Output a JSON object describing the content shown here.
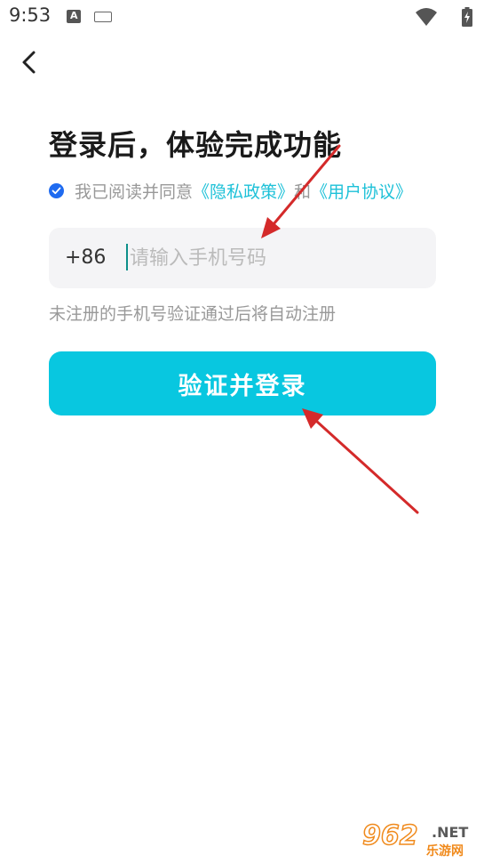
{
  "status_bar": {
    "time": "9:53",
    "app_icon_letter": "A",
    "icons": [
      "a-notification-icon",
      "keyboard-icon",
      "wifi-icon",
      "battery-charging-icon"
    ]
  },
  "header": {
    "back_icon": "chevron-left-icon"
  },
  "title": "登录后，体验完成功能",
  "agreement": {
    "checked": true,
    "prefix": "我已阅读并同意",
    "privacy_link": "《隐私政策》",
    "and": "和",
    "terms_link": "《用户协议》"
  },
  "phone": {
    "country_code": "+86",
    "placeholder": "请输入手机号码",
    "value": ""
  },
  "hint": "未注册的手机号验证通过后将自动注册",
  "submit_label": "验证并登录",
  "watermark": {
    "number": "962",
    "suffix": ".NET",
    "site": "乐游网"
  },
  "colors": {
    "accent": "#08c7e0",
    "link": "#1ec1d8",
    "checkbox": "#1f6bf0",
    "annotation_arrow": "#d42a2a",
    "watermark_orange": "#f08a1c"
  }
}
